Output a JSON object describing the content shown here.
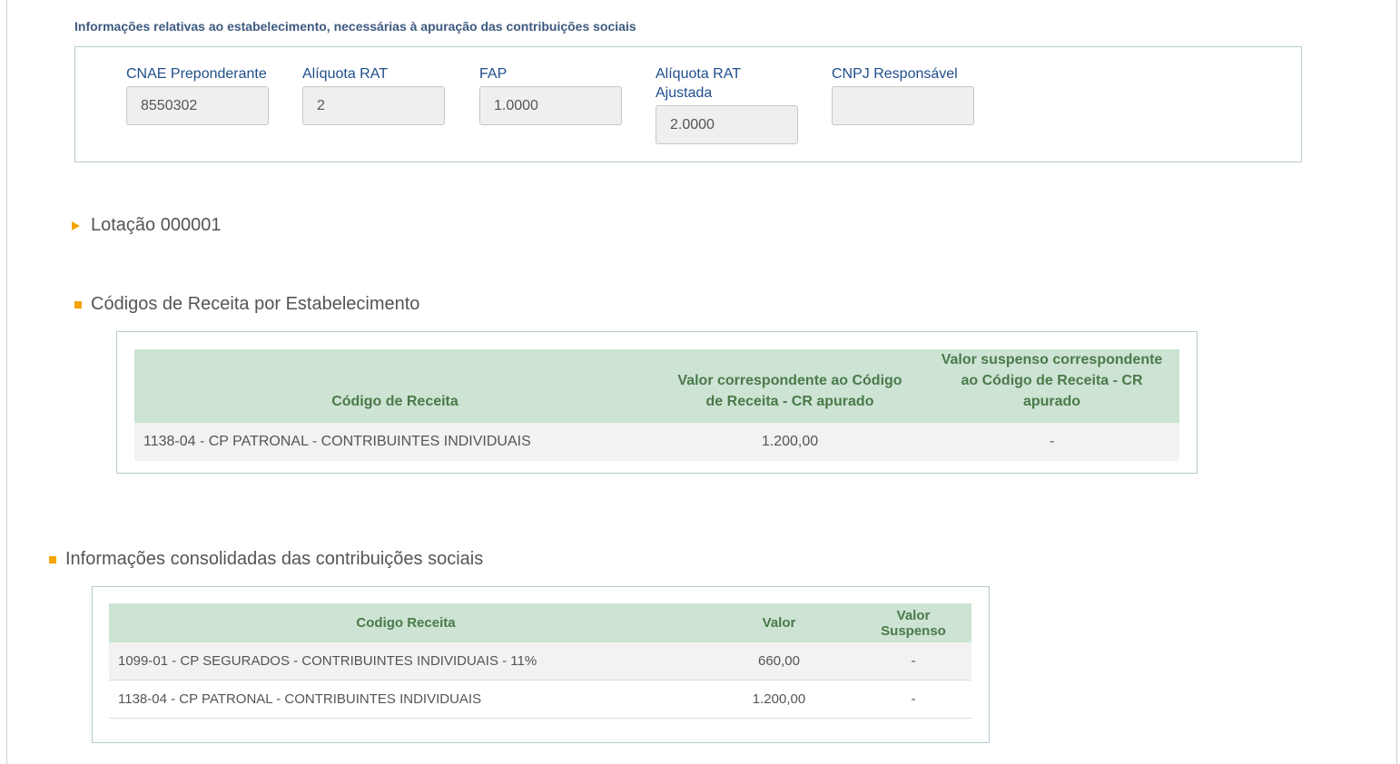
{
  "estabelecimento": {
    "caption": "Informações relativas ao estabelecimento, necessárias à apuração das contribuições sociais",
    "fields": [
      {
        "label": "CNAE Preponderante",
        "value": "8550302"
      },
      {
        "label": "Alíquota RAT",
        "value": "2"
      },
      {
        "label": "FAP",
        "value": "1.0000"
      },
      {
        "label": "Alíquota RAT Ajustada",
        "value": "2.0000"
      },
      {
        "label": "CNPJ Responsável",
        "value": ""
      }
    ]
  },
  "lotacao": {
    "title": "Lotação 000001"
  },
  "codigos_estab": {
    "title": "Códigos de Receita por Estabelecimento",
    "headers": [
      "Código de Receita",
      "Valor correspondente ao Código de Receita - CR apurado",
      "Valor suspenso correspondente ao Código de Receita - CR apurado"
    ],
    "rows": [
      [
        "1138-04 - CP PATRONAL - CONTRIBUINTES INDIVIDUAIS",
        "1.200,00",
        "-"
      ]
    ]
  },
  "consolidadas": {
    "title": "Informações consolidadas das contribuições sociais",
    "headers": [
      "Codigo Receita",
      "Valor",
      "Valor Suspenso"
    ],
    "rows": [
      [
        "1099-01 - CP SEGURADOS - CONTRIBUINTES INDIVIDUAIS - 11%",
        "660,00",
        "-"
      ],
      [
        "1138-04 - CP PATRONAL - CONTRIBUINTES INDIVIDUAIS",
        "1.200,00",
        "-"
      ]
    ]
  },
  "colors": {
    "accent": "#f5a300",
    "header_bg": "#cde3d3",
    "header_text": "#4a7a4a",
    "label": "#1f4e8c"
  }
}
